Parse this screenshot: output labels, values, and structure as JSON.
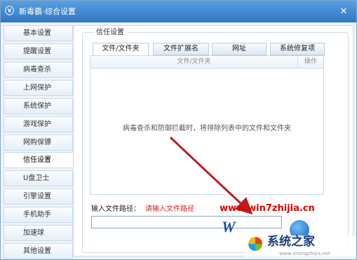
{
  "window": {
    "title": "新毒霸-综合设置",
    "close_glyph": "✕"
  },
  "sidebar": {
    "items": [
      {
        "label": "基本设置"
      },
      {
        "label": "提醒设置"
      },
      {
        "label": "病毒查杀"
      },
      {
        "label": "上网保护"
      },
      {
        "label": "系统保护"
      },
      {
        "label": "游戏保护"
      },
      {
        "label": "网购保镖"
      },
      {
        "label": "信任设置",
        "active": true
      },
      {
        "label": "U盘卫士"
      },
      {
        "label": "引擎设置"
      },
      {
        "label": "手机助手"
      },
      {
        "label": "加速球"
      },
      {
        "label": "其他设置"
      }
    ]
  },
  "trust": {
    "group_title": "信任设置",
    "tabs": [
      {
        "label": "文件/文件夹",
        "active": true
      },
      {
        "label": "文件扩展名"
      },
      {
        "label": "网址"
      },
      {
        "label": "系统修复项"
      }
    ],
    "columns": {
      "file": "文件/文件夹",
      "op": "操作"
    },
    "empty_hint": "病毒查杀和防御拦截时，将排除列表中的文件和文件夹",
    "path_label": "输入文件路径：",
    "path_hint": "请输入文件路径",
    "path_value": ""
  },
  "watermark": {
    "url": "www.win7zhijia.cn",
    "logo_letter": "W",
    "brand": "系统之家",
    "small": "www.xitongzhijia.net"
  },
  "colors": {
    "titlebar": "#3a86d2",
    "accent_red": "#d00000",
    "arrow": "#b82020"
  }
}
